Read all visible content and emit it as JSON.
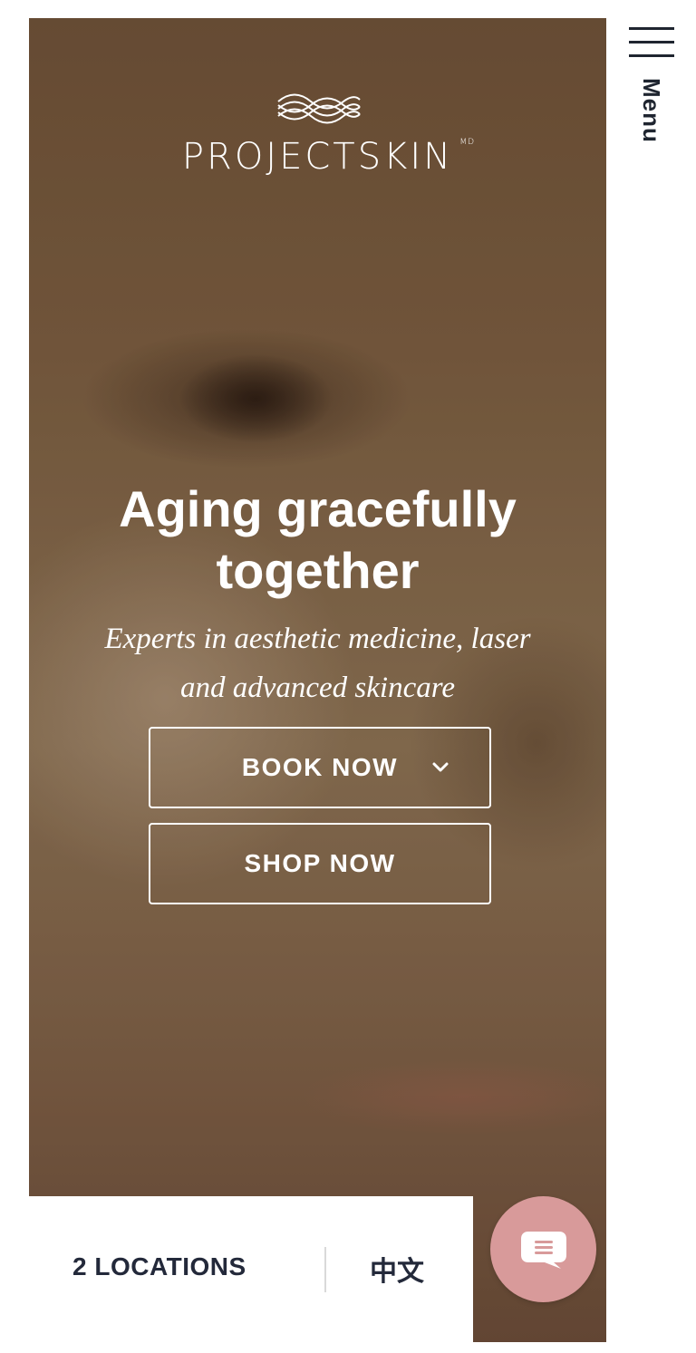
{
  "brand": {
    "logo_text": "PROJECTSKIN",
    "logo_superscript": "MD",
    "logo_icon": "woven-lattice-logo-icon"
  },
  "header": {
    "menu_label": "Menu",
    "menu_icon": "hamburger-icon"
  },
  "hero": {
    "headline_line1": "Aging gracefully",
    "headline_line2": "together",
    "subheadline_line1": "Experts in aesthetic medicine, laser",
    "subheadline_line2": "and advanced skincare",
    "book_button_label": "BOOK NOW",
    "book_button_icon": "chevron-down-icon",
    "shop_button_label": "SHOP NOW"
  },
  "footer_bar": {
    "locations_label": "2 LOCATIONS",
    "language_label": "中文"
  },
  "chat": {
    "icon": "chat-bubble-icon"
  },
  "colors": {
    "chat_button": "#d89a9a",
    "dark_text": "#23293a",
    "white": "#ffffff"
  }
}
